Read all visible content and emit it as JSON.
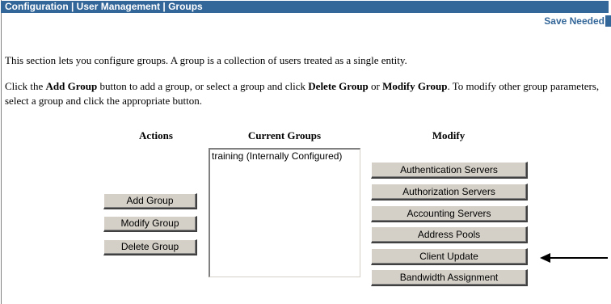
{
  "header": {
    "breadcrumb": "Configuration | User Management | Groups",
    "save_needed": "Save Needed"
  },
  "intro_text": "This section lets you configure groups. A group is a collection of users treated as a single entity.",
  "help": {
    "part1": "Click the ",
    "add_group_ref": "Add Group",
    "part2": " button to add a group, or select a group and click ",
    "delete_group_ref": "Delete Group",
    "part3": " or ",
    "modify_group_ref": "Modify Group",
    "part4": ". To modify other group parameters, select a group and click the appropriate button."
  },
  "columns": {
    "actions": "Actions",
    "current_groups": "Current Groups",
    "modify": "Modify"
  },
  "actions": {
    "add_group": "Add Group",
    "modify_group": "Modify Group",
    "delete_group": "Delete Group"
  },
  "groups": [
    "training (Internally Configured)"
  ],
  "modify_buttons": {
    "authentication_servers": "Authentication Servers",
    "authorization_servers": "Authorization Servers",
    "accounting_servers": "Accounting Servers",
    "address_pools": "Address Pools",
    "client_update": "Client Update",
    "bandwidth_assignment": "Bandwidth Assignment"
  },
  "colors": {
    "titlebar": "#336699",
    "button_face": "#d4d0c8"
  }
}
